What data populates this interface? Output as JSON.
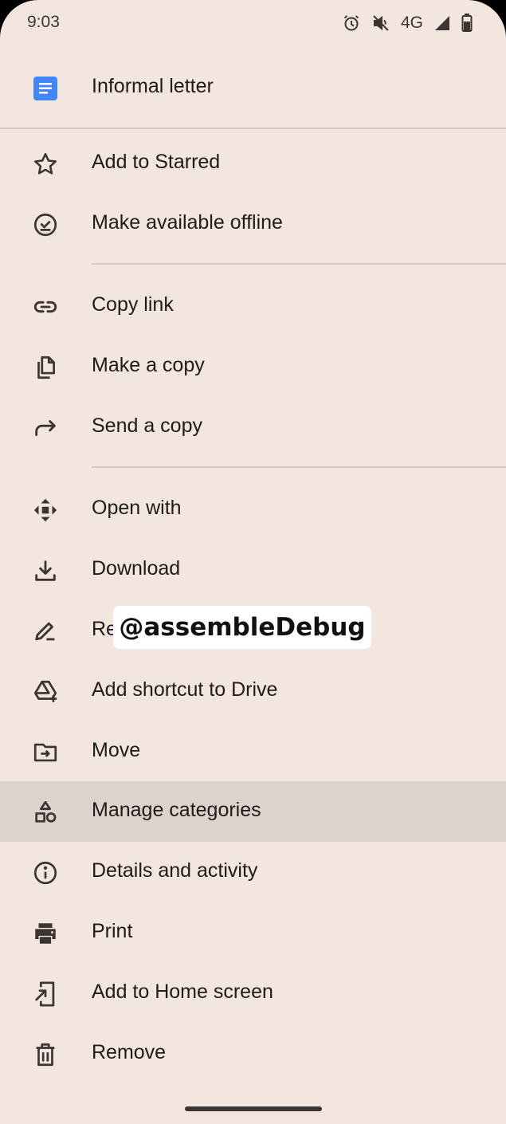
{
  "status_bar": {
    "time": "9:03",
    "network": "4G",
    "icons": [
      "alarm-icon",
      "mute-icon",
      "signal-icon",
      "battery-icon"
    ]
  },
  "header": {
    "doc_icon": "google-docs-icon",
    "doc_icon_color": "#4285f4",
    "title": "Informal letter"
  },
  "menu": {
    "items": [
      {
        "label": "Add to Starred",
        "icon": "star-icon"
      },
      {
        "label": "Make available offline",
        "icon": "offline-check-icon"
      },
      {
        "label": "Copy link",
        "icon": "link-icon"
      },
      {
        "label": "Make a copy",
        "icon": "copy-icon"
      },
      {
        "label": "Send a copy",
        "icon": "share-arrow-icon"
      },
      {
        "label": "Open with",
        "icon": "open-with-icon"
      },
      {
        "label": "Download",
        "icon": "download-icon"
      },
      {
        "label": "Re",
        "icon": "rename-pencil-icon"
      },
      {
        "label": "Add shortcut to Drive",
        "icon": "drive-add-icon"
      },
      {
        "label": "Move",
        "icon": "move-folder-icon"
      },
      {
        "label": "Manage categories",
        "icon": "categories-icon",
        "selected": true
      },
      {
        "label": "Details and activity",
        "icon": "info-icon"
      },
      {
        "label": "Print",
        "icon": "print-icon"
      },
      {
        "label": "Add to Home screen",
        "icon": "add-to-home-icon"
      },
      {
        "label": "Remove",
        "icon": "trash-icon"
      }
    ]
  },
  "watermark": "@assembleDebug",
  "colors": {
    "background": "#f2e6df",
    "selected_row": "#ddd2cc",
    "divider": "#d9c9bf",
    "icon": "#3a3532",
    "text": "#1f1b19"
  }
}
